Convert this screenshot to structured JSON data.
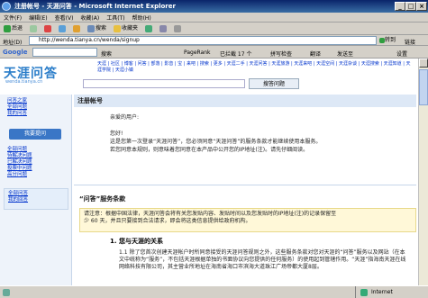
{
  "window": {
    "title": "注册帐号 - 天涯问答 - Microsoft Internet Explorer"
  },
  "menu": [
    "文件(F)",
    "编辑(E)",
    "查看(V)",
    "收藏(A)",
    "工具(T)",
    "帮助(H)"
  ],
  "toolbar": {
    "back": "后退",
    "search": "搜索",
    "favorites": "收藏夹"
  },
  "address": {
    "label": "地址(D)",
    "url": "http://wenda.tianya.cn/wenda/signup",
    "go": "转到",
    "links": "链接"
  },
  "googlebar": {
    "brand": "Google",
    "search": "搜索",
    "pagerank": "PageRank",
    "blocked": "已拦截 17 个",
    "spell": "拼写检查",
    "translate": "翻译",
    "send": "发送至",
    "settings": "设置"
  },
  "site": {
    "logo": "天涯问答",
    "logo_sub": "wenda.tianya.cn",
    "nav": "天涯 | 社区 | 博客 | 问答 | 部落 | 影音 | 宝 | 来吧 | 搜索 | 更多 | 天涯二手 | 天涯问答 | 天涯旅游 | 天涯来吧 | 天涯空间 | 天涯杂谈 | 天涯搜索 | 天涯知道 | 天涯学院 | 天涯小镇",
    "search_btn": "搜答问题"
  },
  "sidebar": {
    "top": [
      "问答之家",
      "全部问题",
      "我的问答"
    ],
    "ask": "我要提问",
    "links1": [
      "全部问题",
      "待解决问题",
      "已解决问题",
      "投票中问题",
      "高分问题"
    ],
    "links2": [
      "全部问答",
      "我的回答",
      "我的提问"
    ]
  },
  "main": {
    "title": "注册帐号",
    "greeting": "亲爱的用户:",
    "hello": "您好!",
    "intro1": "这是您第一次登录“天涯问答”，您必须同意“天涯问答”的服务条款才能继续使用本服务。",
    "intro2": "若您同意本规则，则意味着您同意在本产品中公开您的IP地址(注)。请先仔细阅读。",
    "section": "“问答”服务条款",
    "notice1": "请注意：根据中国法律，天涯问答会将有关您发贴内容、发贴时间以及您发贴时的IP地址(注)的记录保留至",
    "notice2": "少 60 天，并且只要接到合法请求，即会将这类信息提供给政府机构。",
    "sub1": "1. 您与天涯的关系",
    "para1": "1.1 除了您首次创建天涯帐户时所同意接受的天涯问答规则之外，这些服务条款对您对天涯的“问答”服务以及网站（在本文中统称为“服务”，不包括天涯根据单独的书面协议向您提供的任何服务）的使用起到管辖作用。“天涯”指海南天涯在线网络科技有限公司，其主营业所地址在海南省海口市滨海大道珠江广场帝都大厦8层。"
  },
  "status": {
    "zone": "Internet"
  }
}
